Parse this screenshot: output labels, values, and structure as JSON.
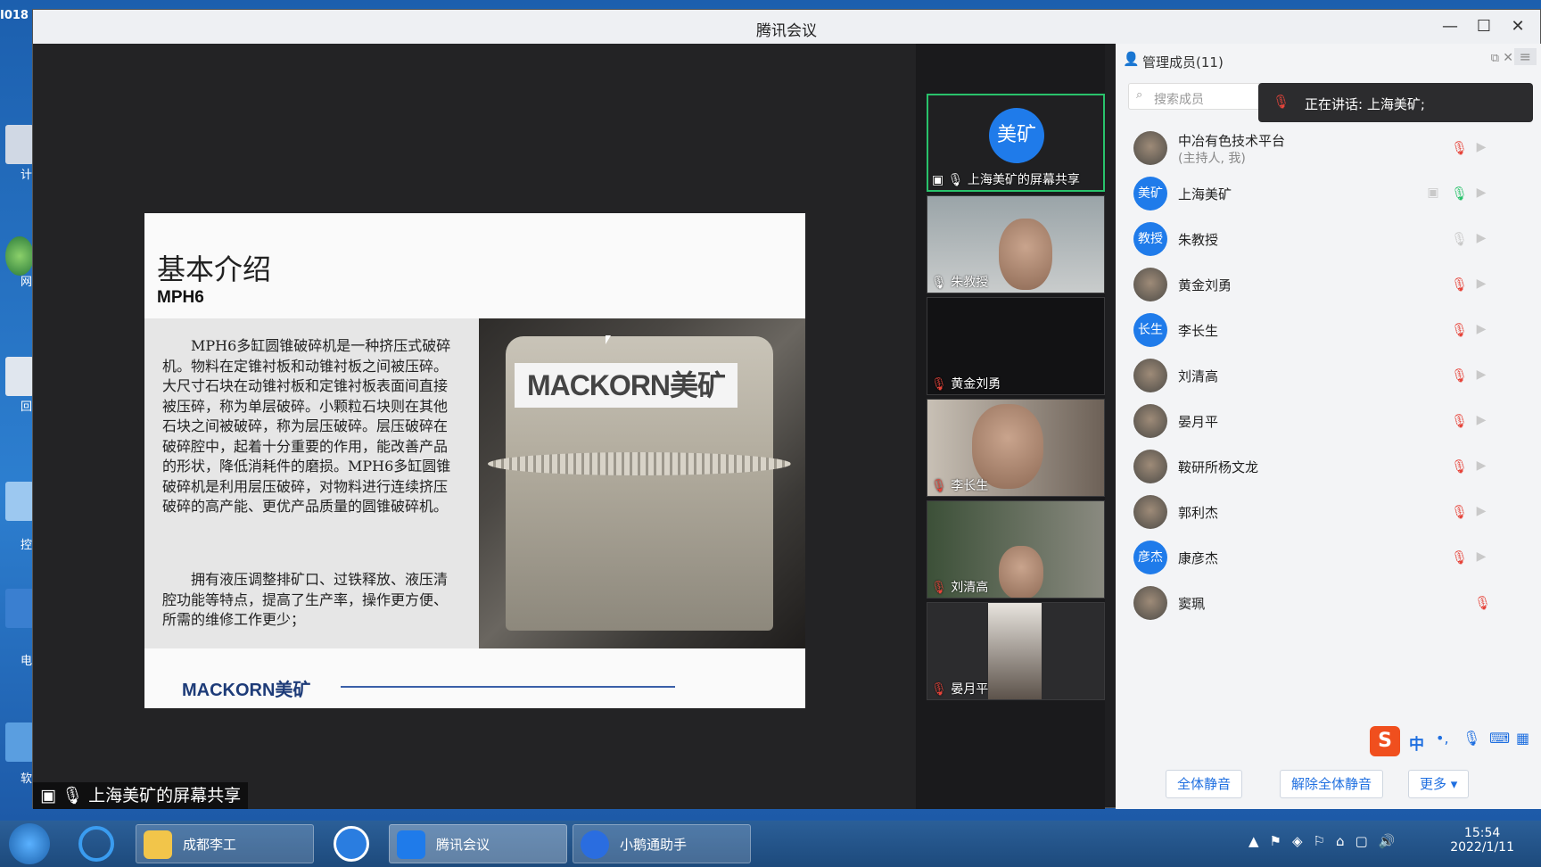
{
  "desktop": {
    "corner_number": "I018",
    "icon_labels": [
      "计",
      "网",
      "回",
      "控",
      "电",
      "软"
    ]
  },
  "window": {
    "title": "腾讯会议",
    "controls": {
      "minimize": "—",
      "maximize": "☐",
      "close": "✕"
    }
  },
  "slide": {
    "heading": "基本介绍",
    "subheading": "MPH6",
    "paragraph1": "MPH6多缸圆锥破碎机是一种挤压式破碎机。物料在定锥衬板和动锥衬板之间被压碎。大尺寸石块在动锥衬板和定锥衬板表面间直接被压碎，称为单层破碎。小颗粒石块则在其他石块之间被破碎，称为层压破碎。层压破碎在破碎腔中，起着十分重要的作用，能改善产品的形状，降低消耗件的磨损。MPH6多缸圆锥破碎机是利用层压破碎，对物料进行连续挤压破碎的高产能、更优产品质量的圆锥破碎机。",
    "paragraph2": "拥有液压调整排矿口、过铁释放、液压清腔功能等特点，提高了生产率，操作更方便、所需的维修工作更少；",
    "photo_brand": "MACKORN美矿",
    "footer_logo": "MACKORN美矿"
  },
  "share_label": "上海美矿的屏幕共享",
  "tiles": [
    {
      "name": "上海美矿的屏幕共享",
      "avatar": "美矿",
      "active": true
    },
    {
      "name": "朱教授"
    },
    {
      "name": "黄金刘勇"
    },
    {
      "name": "李长生"
    },
    {
      "name": "刘清高"
    },
    {
      "name": "晏月平"
    }
  ],
  "panel": {
    "title": "管理成员(11)",
    "search_placeholder": "搜索成员",
    "speaking": "正在讲话: 上海美矿;",
    "members": [
      {
        "name": "中冶有色技术平台",
        "sub": "(主持人, 我)",
        "avatar": "",
        "photo": true,
        "mic": "muted",
        "cam": "off"
      },
      {
        "name": "上海美矿",
        "avatar": "美矿",
        "photo": false,
        "mic": "on",
        "cam": "off",
        "sharing": true
      },
      {
        "name": "朱教授",
        "avatar": "教授",
        "photo": false,
        "mic": "idle",
        "cam": "off"
      },
      {
        "name": "黄金刘勇",
        "avatar": "",
        "photo": true,
        "mic": "muted",
        "cam": "off"
      },
      {
        "name": "李长生",
        "avatar": "长生",
        "photo": false,
        "mic": "muted",
        "cam": "off"
      },
      {
        "name": "刘清高",
        "avatar": "",
        "photo": true,
        "mic": "muted",
        "cam": "off"
      },
      {
        "name": "晏月平",
        "avatar": "",
        "photo": true,
        "mic": "muted",
        "cam": "off"
      },
      {
        "name": "鞍研所杨文龙",
        "avatar": "",
        "photo": true,
        "mic": "muted",
        "cam": "off"
      },
      {
        "name": "郭利杰",
        "avatar": "",
        "photo": true,
        "mic": "muted",
        "cam": "off"
      },
      {
        "name": "康彦杰",
        "avatar": "彦杰",
        "photo": false,
        "mic": "muted",
        "cam": "off"
      },
      {
        "name": "窦珮",
        "avatar": "",
        "photo": true,
        "mic": "muted",
        "cam": "none"
      }
    ],
    "buttons": {
      "mute_all": "全体静音",
      "unmute_all": "解除全体静音",
      "more": "更多 ▾"
    }
  },
  "ime": {
    "label": "中"
  },
  "taskbar": {
    "items": [
      "成都李工",
      "腾讯会议",
      "小鹅通助手"
    ],
    "time": "15:54",
    "date": "2022/1/11"
  },
  "colors": {
    "accent": "#1f7bea",
    "active_tile": "#29c26b",
    "muted": "#e6443a"
  }
}
